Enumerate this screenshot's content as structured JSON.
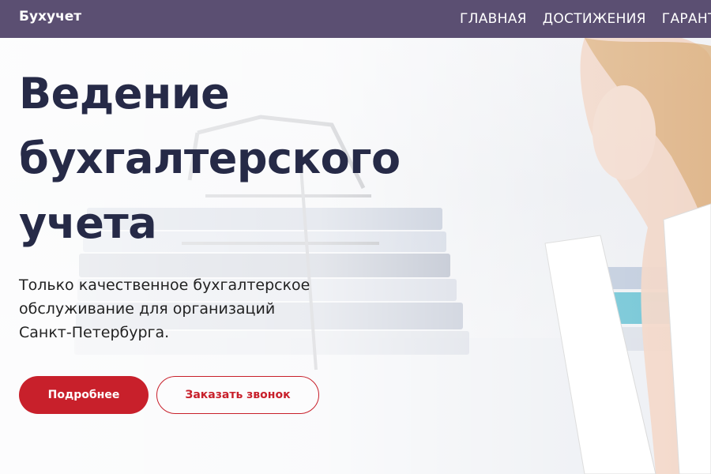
{
  "header": {
    "brand": "Бухучет",
    "nav": [
      "ГЛАВНАЯ",
      "ДОСТИЖЕНИЯ",
      "ГАРАНТИИ"
    ]
  },
  "hero": {
    "title_lines": [
      "Ведение",
      "бухгалтерского",
      "учета"
    ],
    "subtitle_lines": [
      "Только качественное бухгалтерское",
      "обслуживание для организаций",
      "Санкт-Петербурга."
    ],
    "primary_button": "Подробнее",
    "secondary_button": "Заказать звонок"
  },
  "colors": {
    "header_bg": "#5b4f72",
    "title": "#262a47",
    "accent": "#c8202b"
  },
  "background_image": "office-accountant-photo"
}
